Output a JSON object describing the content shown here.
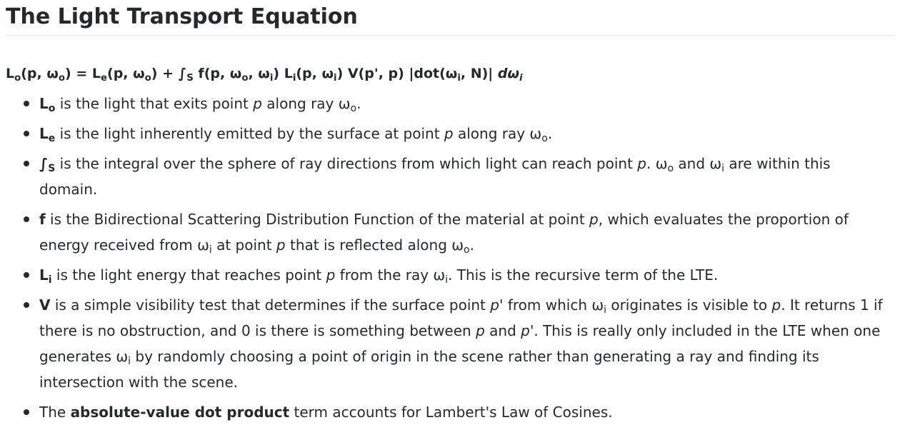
{
  "heading": "The Light Transport Equation",
  "equation": {
    "lo": "L",
    "lo_sub": "o",
    "lhs_args_a": "(p, ω",
    "lhs_args_sub": "o",
    "lhs_args_b": ") = ",
    "le": "L",
    "le_sub": "e",
    "le_args_a": "(p, ω",
    "le_args_sub": "o",
    "le_args_b": ") + ",
    "int": "∫",
    "int_sub": "S",
    "f_a": " f(p, ω",
    "f_sub1": "o",
    "f_b": ", ω",
    "f_sub2": "i",
    "f_c": ") ",
    "li": "L",
    "li_sub": "i",
    "li_args_a": "(p, ω",
    "li_args_sub": "i",
    "li_args_b": ") ",
    "v": "V(p', p) ",
    "dot_a": "|dot(ω",
    "dot_sub": "i",
    "dot_b": ", N)| ",
    "dw": "dω",
    "dw_sub": "i"
  },
  "items": [
    {
      "sym": "L",
      "sym_sub": "o",
      "t1": " is the light that exits point ",
      "p1": "p",
      "t2": " along ray ω",
      "t2_sub": "o",
      "t3": "."
    },
    {
      "sym": "L",
      "sym_sub": "e",
      "t1": " is the light inherently emitted by the surface at point ",
      "p1": "p",
      "t2": " along ray ω",
      "t2_sub": "o",
      "t3": "."
    },
    {
      "sym": "∫",
      "sym_sub": "S",
      "t1": " is the integral over the sphere of ray directions from which light can reach point ",
      "p1": "p",
      "t2": ". ω",
      "t2_sub": "o",
      "t3": " and ω",
      "t3_sub": "i",
      "t4": " are within this domain."
    },
    {
      "sym": "f",
      "t1": " is the Bidirectional Scattering Distribution Function of the material at point ",
      "p1": "p",
      "t2": ", which evaluates the proportion of energy received from ω",
      "t2_sub": "i",
      "t3": " at point ",
      "p2": "p",
      "t4": " that is reflected along ω",
      "t4_sub": "o",
      "t5": "."
    },
    {
      "sym": "L",
      "sym_sub": "i",
      "t1": " is the light energy that reaches point ",
      "p1": "p",
      "t2": " from the ray ω",
      "t2_sub": "i",
      "t3": ". This is the recursive term of the LTE."
    },
    {
      "sym": "V",
      "t1": " is a simple visibility test that determines if the surface point ",
      "p1": "p'",
      "t2": " from which ω",
      "t2_sub": "i",
      "t3": " originates is visible to ",
      "p2": "p",
      "t4": ". It returns 1 if there is no obstruction, and 0 is there is something between ",
      "p3": "p",
      "t5": " and ",
      "p4": "p'",
      "t6": ". This is really only included in the LTE when one generates ω",
      "t6_sub": "i",
      "t7": " by randomly choosing a point of origin in the scene rather than generating a ray and finding its intersection with the scene."
    },
    {
      "t0": "The ",
      "bold": "absolute-value dot product",
      "t1": " term accounts for Lambert's Law of Cosines."
    }
  ]
}
